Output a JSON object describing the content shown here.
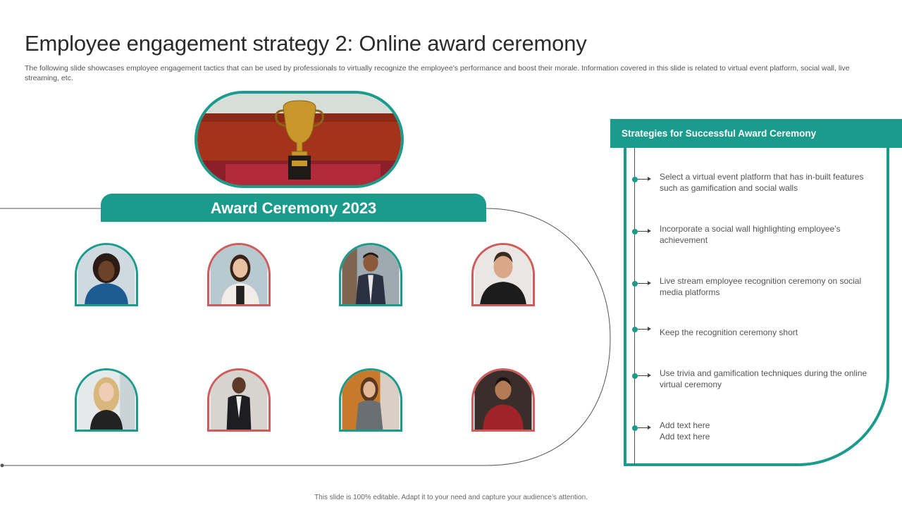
{
  "slide": {
    "title": "Employee engagement strategy 2: Online award ceremony",
    "subtitle": "The following slide showcases employee engagement tactics that can be used by professionals to virtually recognize the employee’s performance and boost their morale. Information covered in this slide is related to virtual event platform, social wall, live streaming, etc.",
    "footer": "This slide is 100% editable. Adapt it to your need and capture your audience’s attention."
  },
  "ceremony": {
    "banner": "Award Ceremony 2023",
    "image_icon": "trophy-icon"
  },
  "employees": [
    {
      "icon": "woman-portrait-icon",
      "frame_color": "#1a9b8b"
    },
    {
      "icon": "woman-portrait-icon",
      "frame_color": "#cf5c5c"
    },
    {
      "icon": "man-portrait-icon",
      "frame_color": "#1a9b8b"
    },
    {
      "icon": "man-portrait-icon",
      "frame_color": "#cf5c5c"
    },
    {
      "icon": "woman-portrait-icon",
      "frame_color": "#1a9b8b"
    },
    {
      "icon": "man-portrait-icon",
      "frame_color": "#cf5c5c"
    },
    {
      "icon": "woman-portrait-icon",
      "frame_color": "#1a9b8b"
    },
    {
      "icon": "man-portrait-icon",
      "frame_color": "#cf5c5c"
    }
  ],
  "strategies": {
    "header": "Strategies for Successful Award Ceremony",
    "items": [
      "Select a virtual  event  platform that has in-built features such as gamification and social walls",
      "Incorporate  a social wall highlighting employee’s achievement",
      "Live stream employee recognition ceremony on social media platforms",
      "Keep the recognition  ceremony short",
      "Use trivia  and gamification techniques during the online virtual  ceremony",
      "Add text here\nAdd text here"
    ]
  },
  "colors": {
    "accent_teal": "#1a9b8b",
    "accent_red": "#cf5c5c"
  }
}
